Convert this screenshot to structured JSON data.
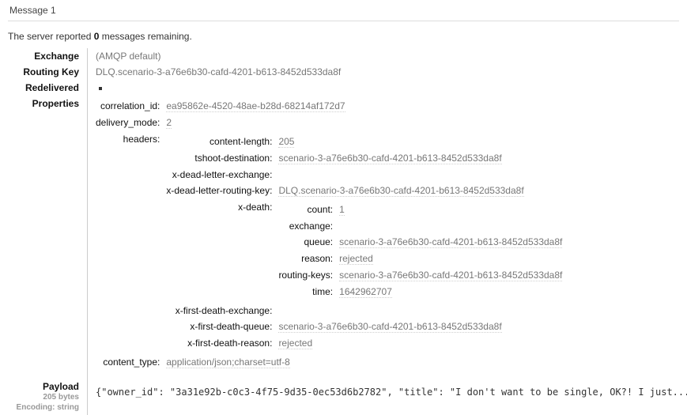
{
  "header": {
    "title": "Message 1"
  },
  "status": {
    "prefix": "The server reported ",
    "count": "0",
    "suffix": " messages remaining."
  },
  "fields": {
    "exchange_label": "Exchange",
    "exchange_value": "(AMQP default)",
    "routing_key_label": "Routing Key",
    "routing_key_value": "DLQ.scenario-3-a76e6b30-cafd-4201-b613-8452d533da8f",
    "redelivered_label": "Redelivered",
    "redelivered_value": "•",
    "properties_label": "Properties"
  },
  "properties": {
    "correlation_id_label": "correlation_id:",
    "correlation_id_value": "ea95862e-4520-48ae-b28d-68214af172d7",
    "delivery_mode_label": "delivery_mode:",
    "delivery_mode_value": "2",
    "headers_label": "headers:",
    "content_type_label": "content_type:",
    "content_type_value": "application/json;charset=utf-8"
  },
  "headers": {
    "content_length_label": "content-length:",
    "content_length_value": "205",
    "tshoot_destination_label": "tshoot-destination:",
    "tshoot_destination_value": "scenario-3-a76e6b30-cafd-4201-b613-8452d533da8f",
    "x_dead_letter_exchange_label": "x-dead-letter-exchange:",
    "x_dead_letter_exchange_value": "",
    "x_dead_letter_routing_key_label": "x-dead-letter-routing-key:",
    "x_dead_letter_routing_key_value": "DLQ.scenario-3-a76e6b30-cafd-4201-b613-8452d533da8f",
    "x_death_label": "x-death:",
    "x_first_death_exchange_label": "x-first-death-exchange:",
    "x_first_death_exchange_value": "",
    "x_first_death_queue_label": "x-first-death-queue:",
    "x_first_death_queue_value": "scenario-3-a76e6b30-cafd-4201-b613-8452d533da8f",
    "x_first_death_reason_label": "x-first-death-reason:",
    "x_first_death_reason_value": "rejected"
  },
  "x_death": {
    "count_label": "count:",
    "count_value": "1",
    "exchange_label": "exchange:",
    "exchange_value": "",
    "queue_label": "queue:",
    "queue_value": "scenario-3-a76e6b30-cafd-4201-b613-8452d533da8f",
    "reason_label": "reason:",
    "reason_value": "rejected",
    "routing_keys_label": "routing-keys:",
    "routing_keys_value": "scenario-3-a76e6b30-cafd-4201-b613-8452d533da8f",
    "time_label": "time:",
    "time_value": "1642962707"
  },
  "payload": {
    "title": "Payload",
    "bytes": "205 bytes",
    "encoding": "Encoding: string",
    "body": "{\"owner_id\": \"3a31e92b-c0c3-4f75-9d35-0ec53d6b2782\", \"title\": \"I don't want to be single, OK?! I just..."
  }
}
